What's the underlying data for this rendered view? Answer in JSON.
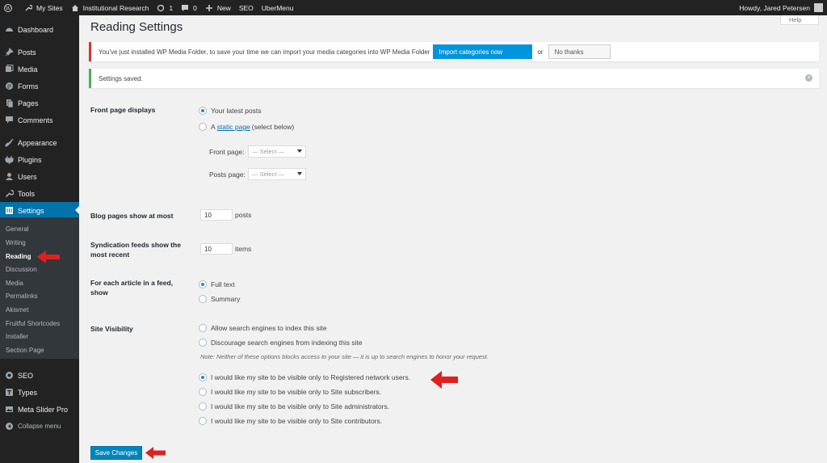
{
  "adminbar": {
    "my_sites": "My Sites",
    "site_name": "Institutional Research",
    "updates_count": "1",
    "comments_count": "0",
    "new_label": "New",
    "seo_label": "SEO",
    "ubermenu_label": "UberMenu",
    "howdy": "Howdy, Jared Petersen"
  },
  "sidebar": {
    "menu": [
      {
        "label": "Dashboard",
        "icon": "dashboard-icon"
      },
      {
        "label": "Posts",
        "icon": "pin-icon"
      },
      {
        "label": "Media",
        "icon": "media-icon"
      },
      {
        "label": "Forms",
        "icon": "forms-icon"
      },
      {
        "label": "Pages",
        "icon": "pages-icon"
      },
      {
        "label": "Comments",
        "icon": "comment-icon"
      },
      {
        "label": "Appearance",
        "icon": "brush-icon"
      },
      {
        "label": "Plugins",
        "icon": "plugin-icon"
      },
      {
        "label": "Users",
        "icon": "user-icon"
      },
      {
        "label": "Tools",
        "icon": "wrench-icon"
      },
      {
        "label": "Settings",
        "icon": "settings-icon"
      }
    ],
    "submenu": [
      "General",
      "Writing",
      "Reading",
      "Discussion",
      "Media",
      "Permalinks",
      "Akismet",
      "Fruitful Shortcodes",
      "Installer",
      "Section Page"
    ],
    "menu_bottom": [
      {
        "label": "SEO",
        "icon": "seo-icon"
      },
      {
        "label": "Types",
        "icon": "types-icon"
      },
      {
        "label": "Meta Slider Pro",
        "icon": "slider-icon"
      }
    ],
    "collapse_label": "Collapse menu"
  },
  "page": {
    "title": "Reading Settings",
    "help_label": "Help"
  },
  "notices": {
    "wpmf_text": "You've just installed WP Media Folder, to save your time we can import your media categories into WP Media Folder",
    "import_label": "Import categories now",
    "or_label": "or",
    "nothanks_label": "No thanks",
    "saved_text": "Settings saved."
  },
  "form": {
    "front_page_label": "Front page displays",
    "latest_posts_label": "Your latest posts",
    "static_prefix": "A",
    "static_link": "static page",
    "static_suffix": "(select below)",
    "front_page_select_label": "Front page:",
    "posts_page_select_label": "Posts page:",
    "select_placeholder": "— Select —",
    "blog_pages_label": "Blog pages show at most",
    "blog_pages_value": "10",
    "blog_pages_unit": "posts",
    "syndication_label": "Syndication feeds show the most recent",
    "syndication_value": "10",
    "syndication_unit": "items",
    "feed_article_label": "For each article in a feed, show",
    "full_text_label": "Full text",
    "summary_label": "Summary",
    "visibility_label": "Site Visibility",
    "allow_label": "Allow search engines to index this site",
    "discourage_label": "Discourage search engines from indexing this site",
    "visibility_note": "Note: Neither of these options blocks access to your site — it is up to search engines to honor your request.",
    "registered_label": "I would like my site to be visible only to Registered network users.",
    "subscribers_label": "I would like my site to be visible only to Site subscribers.",
    "admins_label": "I would like my site to be visible only to Site administrators.",
    "contributors_label": "I would like my site to be visible only to Site contributors.",
    "save_label": "Save Changes"
  },
  "colors": {
    "accent": "#0073aa",
    "admin_dark": "#222222",
    "annotation_arrow": "#e02020"
  }
}
